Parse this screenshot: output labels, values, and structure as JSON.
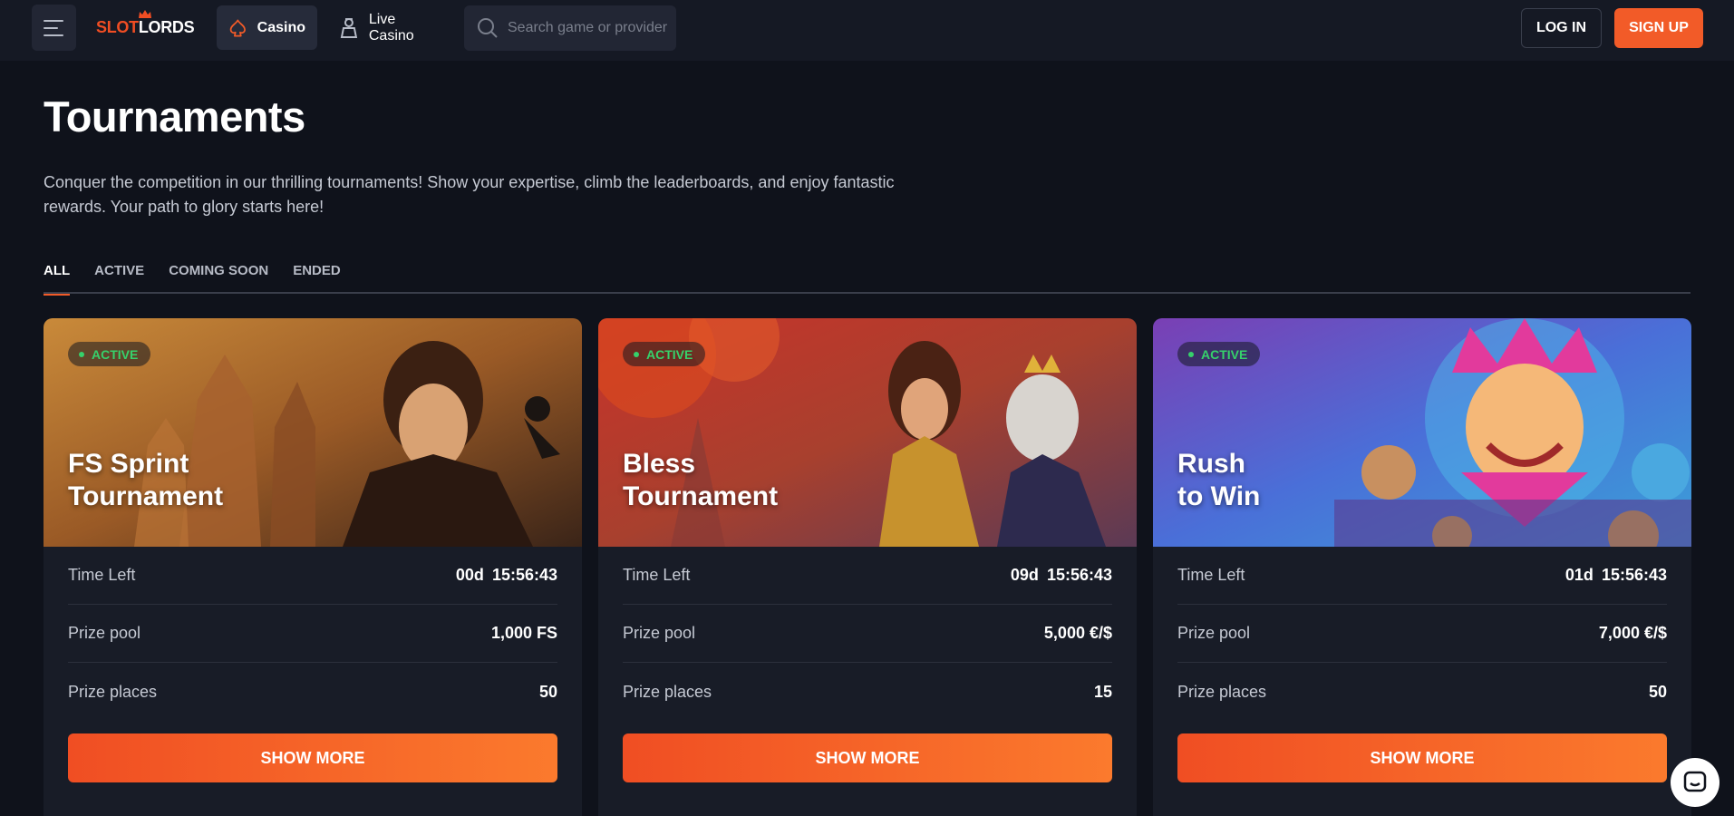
{
  "header": {
    "logo_part1": "SLOT",
    "logo_part2": "LORDS",
    "nav_casino": "Casino",
    "nav_live_casino": "Live Casino",
    "search_placeholder": "Search game or provider",
    "login_label": "LOG IN",
    "signup_label": "SIGN UP"
  },
  "page": {
    "title": "Tournaments",
    "description": "Conquer the competition in our thrilling tournaments! Show your expertise, climb the leaderboards, and enjoy fantastic rewards. Your path to glory starts here!"
  },
  "tabs": [
    {
      "label": "ALL",
      "active": true
    },
    {
      "label": "ACTIVE",
      "active": false
    },
    {
      "label": "COMING SOON",
      "active": false
    },
    {
      "label": "ENDED",
      "active": false
    }
  ],
  "cards": [
    {
      "status": "ACTIVE",
      "title_line1": "FS Sprint",
      "title_line2": "Tournament",
      "time_left_label": "Time Left",
      "time_days": "00d",
      "time_clock": "15:56:43",
      "prize_pool_label": "Prize pool",
      "prize_pool": "1,000 FS",
      "prize_places_label": "Prize places",
      "prize_places": "50",
      "button_label": "SHOW MORE"
    },
    {
      "status": "ACTIVE",
      "title_line1": "Bless",
      "title_line2": "Tournament",
      "time_left_label": "Time Left",
      "time_days": "09d",
      "time_clock": "15:56:43",
      "prize_pool_label": "Prize pool",
      "prize_pool": "5,000 €/$",
      "prize_places_label": "Prize places",
      "prize_places": "15",
      "button_label": "SHOW MORE"
    },
    {
      "status": "ACTIVE",
      "title_line1": "Rush",
      "title_line2": "to Win",
      "time_left_label": "Time Left",
      "time_days": "01d",
      "time_clock": "15:56:43",
      "prize_pool_label": "Prize pool",
      "prize_pool": "7,000 €/$",
      "prize_places_label": "Prize places",
      "prize_places": "50",
      "button_label": "SHOW MORE"
    }
  ],
  "colors": {
    "accent": "#f25b28",
    "active_green": "#36d16b",
    "background": "#0f121b"
  },
  "icons": [
    "menu-icon",
    "spade-icon",
    "dealer-icon",
    "search-icon",
    "chat-icon"
  ]
}
